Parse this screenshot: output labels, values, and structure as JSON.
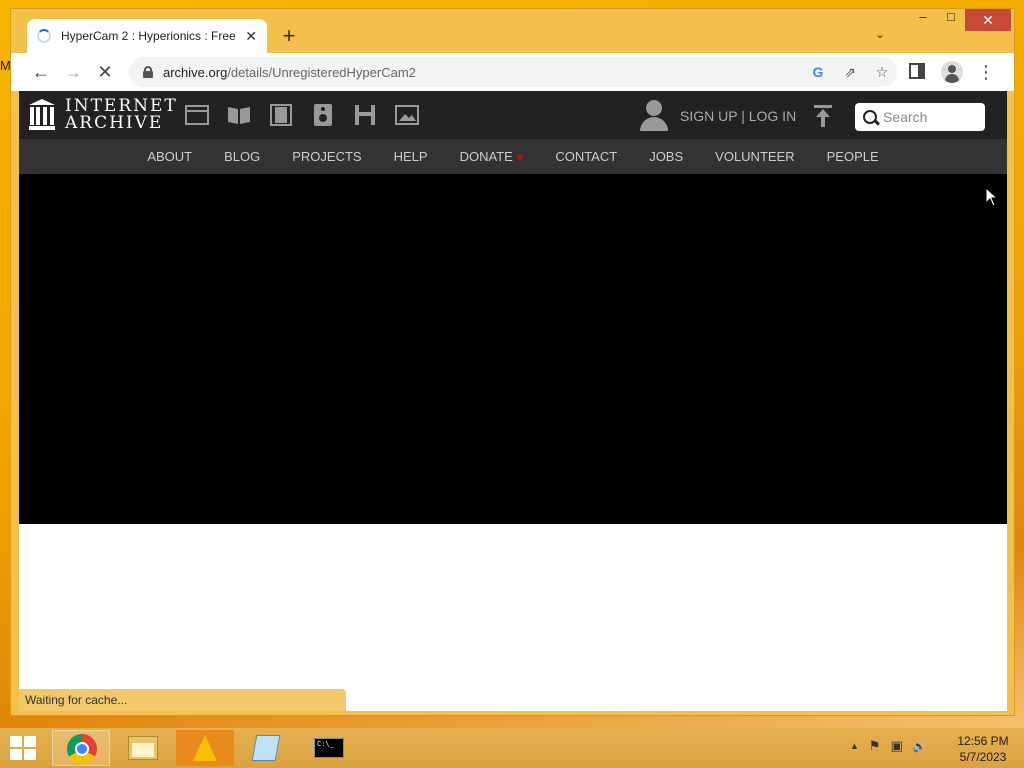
{
  "desktop": {
    "edge_letter": "M"
  },
  "browser": {
    "tab": {
      "title": "HyperCam 2 : Hyperionics : Free"
    },
    "new_tab_glyph": "+",
    "tab_list_glyph": "⌄",
    "window_controls": {
      "min": "–",
      "max": "□",
      "close": "✕"
    },
    "nav": {
      "back": "←",
      "forward": "→",
      "stop": "✕"
    },
    "address": {
      "host": "archive.org",
      "path": "/details/UnregisteredHyperCam2"
    },
    "icons": {
      "google": "G",
      "share": "⇗",
      "star": "☆",
      "menu": "⋮"
    }
  },
  "archive": {
    "logo_line1": "INTERNET",
    "logo_line2": "ARCHIVE",
    "signup": "SIGN UP | LOG IN",
    "search_placeholder": "Search",
    "subnav": [
      "ABOUT",
      "BLOG",
      "PROJECTS",
      "HELP",
      "DONATE",
      "CONTACT",
      "JOBS",
      "VOLUNTEER",
      "PEOPLE"
    ],
    "donate_heart": "♥",
    "media_icons": [
      "web-icon",
      "texts-icon",
      "video-icon",
      "audio-icon",
      "software-icon",
      "images-icon"
    ]
  },
  "status": {
    "text": "Waiting for cache..."
  },
  "taskbar": {
    "tray_icons": {
      "chevron": "▲",
      "flag": "⚑",
      "network": "▣",
      "volume": "🔊"
    },
    "console_glyph": "C:\\_",
    "clock": {
      "time": "12:56 PM",
      "date": "5/7/2023"
    }
  },
  "colors": {
    "accent_orange": "#f0a400",
    "ia_topnav": "#222222",
    "ia_subnav": "#333333",
    "close_button": "#c74a38",
    "donate_heart": "#e00000"
  }
}
